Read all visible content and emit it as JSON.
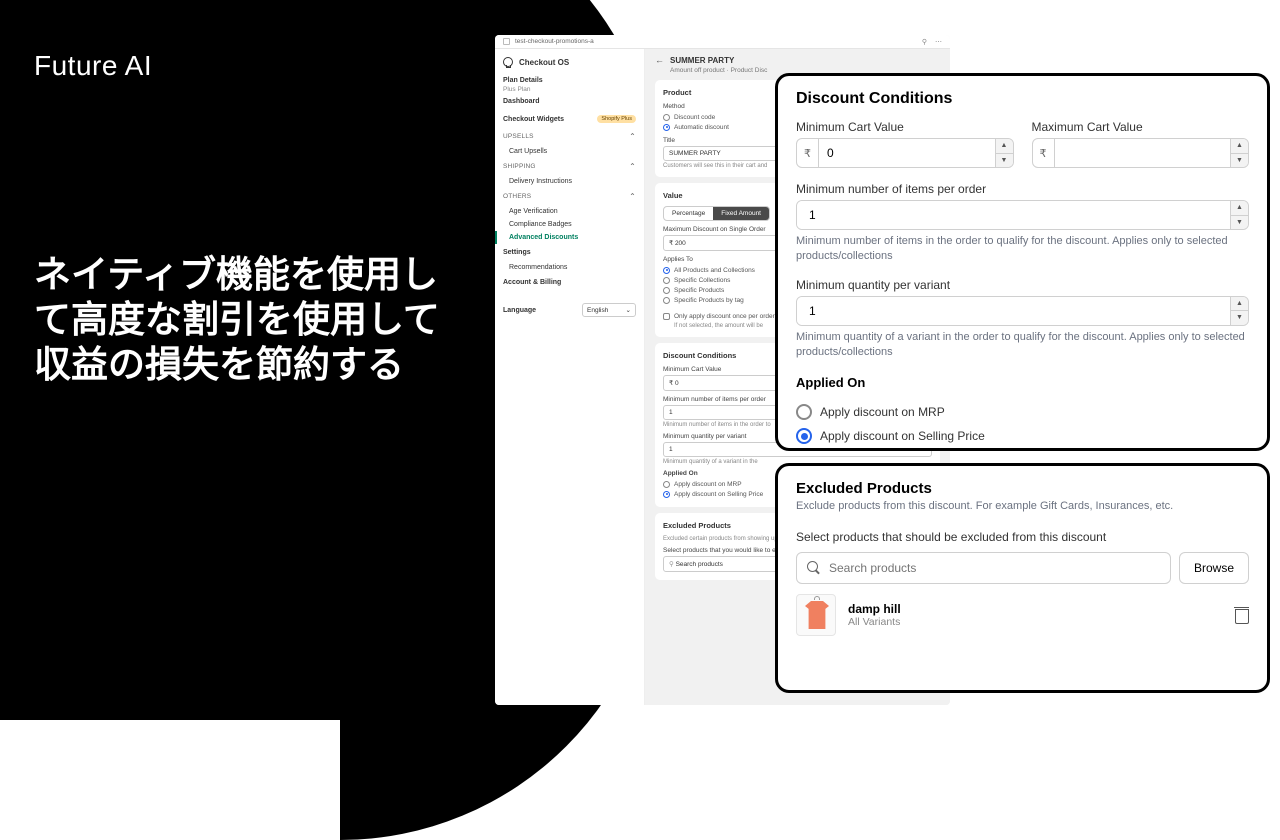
{
  "hero": {
    "brand": "Future AI",
    "tagline": "ネイティブ機能を使用して高度な割引を使用して収益の損失を節約する"
  },
  "topbar": {
    "crumb": "test-checkout-promotions-a"
  },
  "sidebar": {
    "app_name": "Checkout OS",
    "plan_t": "Plan Details",
    "plan_sub": "Plus Plan",
    "dashboard": "Dashboard",
    "widgets_t": "Checkout Widgets",
    "widgets_badge": "Shopify Plus",
    "grp_upsells": "UPSELLS",
    "item_cart_upsells": "Cart Upsells",
    "grp_shipping": "SHIPPING",
    "item_delivery": "Delivery Instructions",
    "grp_others": "OTHERS",
    "item_age": "Age Verification",
    "item_compliance": "Compliance Badges",
    "item_adv": "Advanced Discounts",
    "settings_t": "Settings",
    "item_reco": "Recommendations",
    "account_t": "Account & Billing",
    "lang_t": "Language",
    "lang_val": "English"
  },
  "main": {
    "title": "SUMMER PARTY",
    "subtitle": "Amount off product · Product Disc",
    "product_t": "Product",
    "method_t": "Method",
    "m_code": "Discount code",
    "m_auto": "Automatic discount",
    "title_lbl": "Title",
    "title_val": "SUMMER PARTY",
    "title_hint": "Customers will see this in their cart and",
    "value_t": "Value",
    "seg_pct": "Percentage",
    "seg_fix": "Fixed Amount",
    "max_lbl": "Maximum Discount on Single Order",
    "max_val": "₹  200",
    "applies_t": "Applies To",
    "ap_all": "All Products and Collections",
    "ap_col": "Specific Collections",
    "ap_prod": "Specific Products",
    "ap_tag": "Specific Products by tag",
    "once_lbl": "Only apply discount once per order",
    "once_hint": "If not selected, the amount will be",
    "cond_t": "Discount Conditions",
    "min_cart_lbl": "Minimum Cart Value",
    "min_cart_val": "₹  0",
    "min_items_lbl": "Minimum number of items per order",
    "min_items_val": "1",
    "min_items_hint": "Minimum number of items in the order to",
    "min_qty_lbl": "Minimum quantity per variant",
    "min_qty_val": "1",
    "min_qty_hint": "Minimum quantity of a variant in the",
    "applied_t": "Applied On",
    "applied_mrp": "Apply discount on MRP",
    "applied_sell": "Apply discount on Selling Price",
    "excl_t": "Excluded Products",
    "excl_hint": "Excluded certain products from showing up",
    "excl_sel": "Select products that you would like to e",
    "excl_search": "Search products"
  },
  "ov1": {
    "title": "Discount Conditions",
    "min_cart": "Minimum Cart Value",
    "min_cart_v": "0",
    "max_cart": "Maximum Cart Value",
    "max_cart_v": "",
    "cur": "₹",
    "min_items": "Minimum number of items per order",
    "min_items_v": "1",
    "min_items_hint": "Minimum number of items in the order to qualify for the discount. Applies only to selected products/collections",
    "min_qty": "Minimum quantity per variant",
    "min_qty_v": "1",
    "min_qty_hint": "Minimum quantity of a variant in the order to qualify for the discount. Applies only to selected products/collections",
    "applied": "Applied On",
    "r_mrp": "Apply discount on MRP",
    "r_sell": "Apply discount on Selling Price"
  },
  "ov2": {
    "title": "Excluded Products",
    "sub": "Exclude products from this discount. For example Gift Cards, Insurances, etc.",
    "sel": "Select products that should be excluded from this discount",
    "placeholder": "Search products",
    "browse": "Browse",
    "p_name": "damp hill",
    "p_var": "All Variants"
  }
}
